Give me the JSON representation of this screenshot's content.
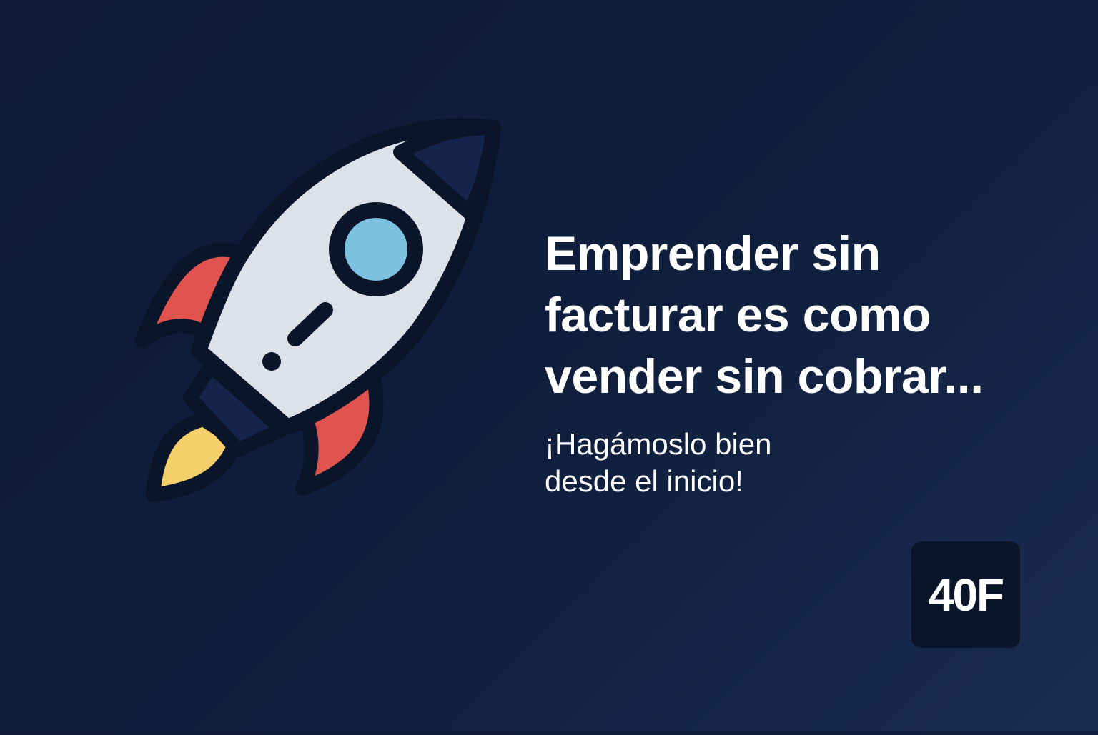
{
  "headline": {
    "lines": [
      "Emprender sin",
      "facturar es como",
      "vender sin cobrar..."
    ]
  },
  "subheadline": {
    "lines": [
      "¡Hagámoslo bien",
      "desde el inicio!"
    ]
  },
  "logo": {
    "text": "40F"
  },
  "icons": {
    "illustration": "rocket-icon"
  },
  "colors": {
    "background": "#0f1f3d",
    "rocket_body": "#dde1ea",
    "rocket_nose": "#15244a",
    "window": "#7cc1df",
    "fins": "#e0534f",
    "flame": "#f4cf6a",
    "outline": "#0b1529",
    "text": "#ffffff",
    "logo_bg": "#0b1529"
  }
}
